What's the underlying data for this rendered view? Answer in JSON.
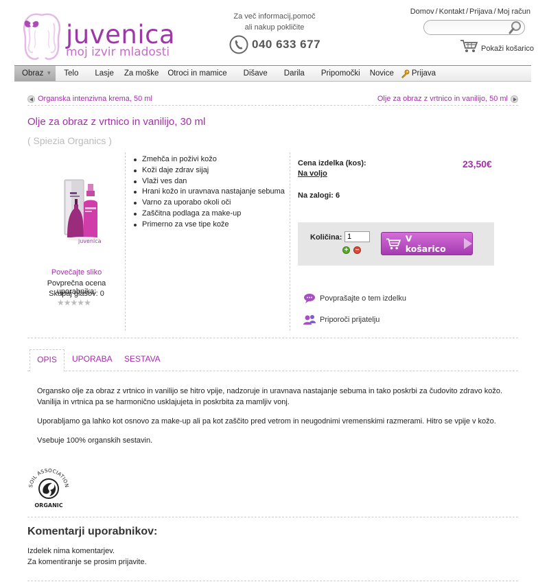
{
  "brand": {
    "name": "juvenica",
    "tagline": "moj izvir mladosti",
    "color_primary": "#a32fa8"
  },
  "contact": {
    "line1": "Za več informacij,pomoč",
    "line2": "ali nakup pokličite",
    "phone": "040 633 677"
  },
  "top_links": [
    "Domov",
    "Kontakt",
    "Prijava",
    "Moj račun"
  ],
  "search": {
    "placeholder": "",
    "value": ""
  },
  "cart": {
    "label": "Pokaži košarico"
  },
  "nav": {
    "items": [
      "Obraz",
      "Telo",
      "Lasje",
      "Za moške",
      "Otroci in mamice",
      "Dišave",
      "Darila",
      "Pripomočki",
      "Novice",
      "Prijava"
    ],
    "active": "Obraz"
  },
  "prev_product": "Organska intenzivna krema, 50 ml",
  "next_product": "Olje za obraz z vrtnico in vanilijo, 50 ml",
  "product": {
    "title": "Olje za obraz z vrtnico in vanilijo, 30 ml",
    "manufacturer": "( Spiezia Organics )",
    "image_brand": "juvenica",
    "enlarge_label": "Povečajte sliko",
    "rating_label": "Povprečna ocena uporabnika:",
    "votes_label": "Skupaj glasov: 0",
    "rating_stars": 0,
    "features": [
      "Zmehča in poživi kožo",
      "Koži daje zdrav sijaj",
      "Vlaži ves dan",
      "Hrani kožo in uravnava nastajanje sebuma",
      "Varno za uporabo okoli oči",
      "Zaščitna podlaga za make-up",
      "Primerno za vse tipe kože"
    ],
    "price_label": "Cena izdelka (kos):",
    "availability": "Na voljo",
    "price": "23,50€",
    "stock_label": "Na zalogi: 6",
    "quantity_label": "Količina:",
    "quantity_value": "1",
    "add_to_cart_label": "V košarico",
    "ask_label": "Povprašajte o tem izdelku",
    "recommend_label": "Priporoči prijatelju"
  },
  "tabs": [
    "OPIS",
    "UPORABA",
    "SESTAVA"
  ],
  "active_tab": "OPIS",
  "description": [
    "Organsko olje za obraz z vrtnico in vanilijo se hitro vpije, nadzoruje in uravnava nastajanje sebuma in tako poskrbi za čudovito zdravo kožo. Vanilija in vrtnica pa se harmonično usklajujeta in poskrbita za mamljiv vonj.",
    "Uporabljamo ga lahko kot osnovo za make-up ali pa kot zaščito pred vetrom in neugodnimi vremenskimi razmerami. Hitro se vpije v kožo.",
    "Vsebuje 100% organskih sestavin."
  ],
  "soil_logo": {
    "top": "SOIL ASSOCIATION",
    "bottom": "ORGANIC"
  },
  "comments": {
    "title": "Komentarji uporabnikov:",
    "none": "Izdelek nima komentarjev.",
    "login_prompt": "Za komentiranje se prosim prijavite."
  }
}
